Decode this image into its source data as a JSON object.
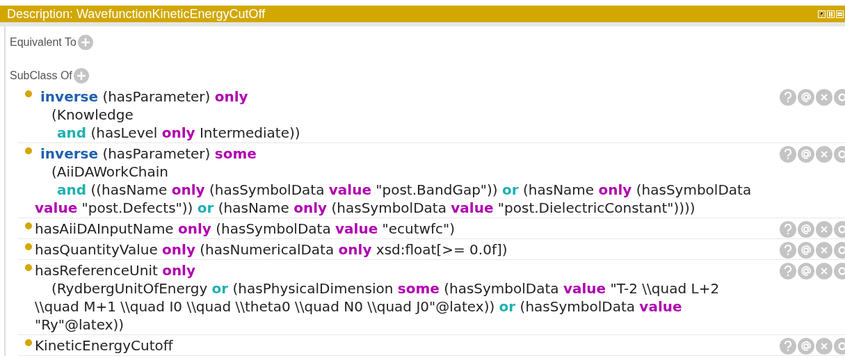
{
  "header": {
    "title": "Description: WavefunctionKineticEnergyCutOff"
  },
  "sections": [
    {
      "label": "Equivalent To"
    },
    {
      "label": "SubClass Of",
      "axioms": [
        {
          "lines": [
            {
              "kind": "inverse_head",
              "tokens": [
                {
                  "kind": "inverse",
                  "text": "inverse"
                },
                {
                  "kind": "plain",
                  "text": " (hasParameter) "
                },
                {
                  "kind": "keyword",
                  "text": "only"
                }
              ]
            },
            {
              "kind": "group",
              "tokens": [
                {
                  "kind": "plain",
                  "text": "(Knowledge"
                }
              ]
            },
            {
              "kind": "member",
              "tokens": [
                {
                  "kind": "connective",
                  "text": "and"
                },
                {
                  "kind": "plain",
                  "text": " (hasLevel "
                },
                {
                  "kind": "keyword",
                  "text": "only"
                },
                {
                  "kind": "plain",
                  "text": " Intermediate))"
                }
              ]
            }
          ]
        },
        {
          "lines": [
            {
              "kind": "inverse_head",
              "tokens": [
                {
                  "kind": "inverse",
                  "text": "inverse"
                },
                {
                  "kind": "plain",
                  "text": " (hasParameter) "
                },
                {
                  "kind": "keyword",
                  "text": "some"
                }
              ]
            },
            {
              "kind": "group",
              "tokens": [
                {
                  "kind": "plain",
                  "text": "(AiiDAWorkChain"
                }
              ]
            },
            {
              "kind": "member",
              "tokens": [
                {
                  "kind": "connective",
                  "text": "and"
                },
                {
                  "kind": "plain",
                  "text": " ((hasName "
                },
                {
                  "kind": "keyword",
                  "text": "only"
                },
                {
                  "kind": "plain",
                  "text": " (hasSymbolData "
                },
                {
                  "kind": "keyword",
                  "text": "value"
                },
                {
                  "kind": "plain",
                  "text": " \"post.BandGap\")) "
                },
                {
                  "kind": "connective",
                  "text": "or"
                },
                {
                  "kind": "plain",
                  "text": " (hasName "
                },
                {
                  "kind": "keyword",
                  "text": "only"
                },
                {
                  "kind": "plain",
                  "text": " (hasSymbolData"
                }
              ]
            },
            {
              "kind": "wrap",
              "tokens": [
                {
                  "kind": "keyword",
                  "text": "value"
                },
                {
                  "kind": "plain",
                  "text": " \"post.Defects\")) "
                },
                {
                  "kind": "connective",
                  "text": "or"
                },
                {
                  "kind": "plain",
                  "text": " (hasName "
                },
                {
                  "kind": "keyword",
                  "text": "only"
                },
                {
                  "kind": "plain",
                  "text": " (hasSymbolData "
                },
                {
                  "kind": "keyword",
                  "text": "value"
                },
                {
                  "kind": "plain",
                  "text": " \"post.DielectricConstant\"))))"
                }
              ]
            }
          ]
        },
        {
          "lines": [
            {
              "kind": "head",
              "tokens": [
                {
                  "kind": "plain",
                  "text": "hasAiiDAInputName "
                },
                {
                  "kind": "keyword",
                  "text": "only"
                },
                {
                  "kind": "plain",
                  "text": " (hasSymbolData "
                },
                {
                  "kind": "keyword",
                  "text": "value"
                },
                {
                  "kind": "plain",
                  "text": " \"ecutwfc\")"
                }
              ]
            }
          ]
        },
        {
          "lines": [
            {
              "kind": "head",
              "tokens": [
                {
                  "kind": "plain",
                  "text": "hasQuantityValue "
                },
                {
                  "kind": "keyword",
                  "text": "only"
                },
                {
                  "kind": "plain",
                  "text": " (hasNumericalData "
                },
                {
                  "kind": "keyword",
                  "text": "only"
                },
                {
                  "kind": "plain",
                  "text": " xsd:float[>= 0.0f])"
                }
              ]
            }
          ]
        },
        {
          "lines": [
            {
              "kind": "head",
              "tokens": [
                {
                  "kind": "plain",
                  "text": "hasReferenceUnit "
                },
                {
                  "kind": "keyword",
                  "text": "only"
                }
              ]
            },
            {
              "kind": "group",
              "tokens": [
                {
                  "kind": "plain",
                  "text": "(RydbergUnitOfEnergy "
                },
                {
                  "kind": "connective",
                  "text": "or"
                },
                {
                  "kind": "plain",
                  "text": " (hasPhysicalDimension "
                },
                {
                  "kind": "keyword",
                  "text": "some"
                },
                {
                  "kind": "plain",
                  "text": " (hasSymbolData "
                },
                {
                  "kind": "keyword",
                  "text": "value"
                },
                {
                  "kind": "plain",
                  "text": " \"T-2 \\\\quad L+2"
                }
              ]
            },
            {
              "kind": "wrap",
              "tokens": [
                {
                  "kind": "plain",
                  "text": "\\\\quad M+1 \\\\quad I0 \\\\quad \\\\theta0 \\\\quad N0 \\\\quad J0\"@latex)) "
                },
                {
                  "kind": "connective",
                  "text": "or"
                },
                {
                  "kind": "plain",
                  "text": " (hasSymbolData "
                },
                {
                  "kind": "keyword",
                  "text": "value"
                }
              ]
            },
            {
              "kind": "wrap",
              "tokens": [
                {
                  "kind": "plain",
                  "text": "\"Ry\"@latex))"
                }
              ]
            }
          ]
        },
        {
          "lines": [
            {
              "kind": "head",
              "tokens": [
                {
                  "kind": "plain",
                  "text": "KineticEnergyCutoff"
                }
              ]
            }
          ]
        }
      ]
    }
  ]
}
